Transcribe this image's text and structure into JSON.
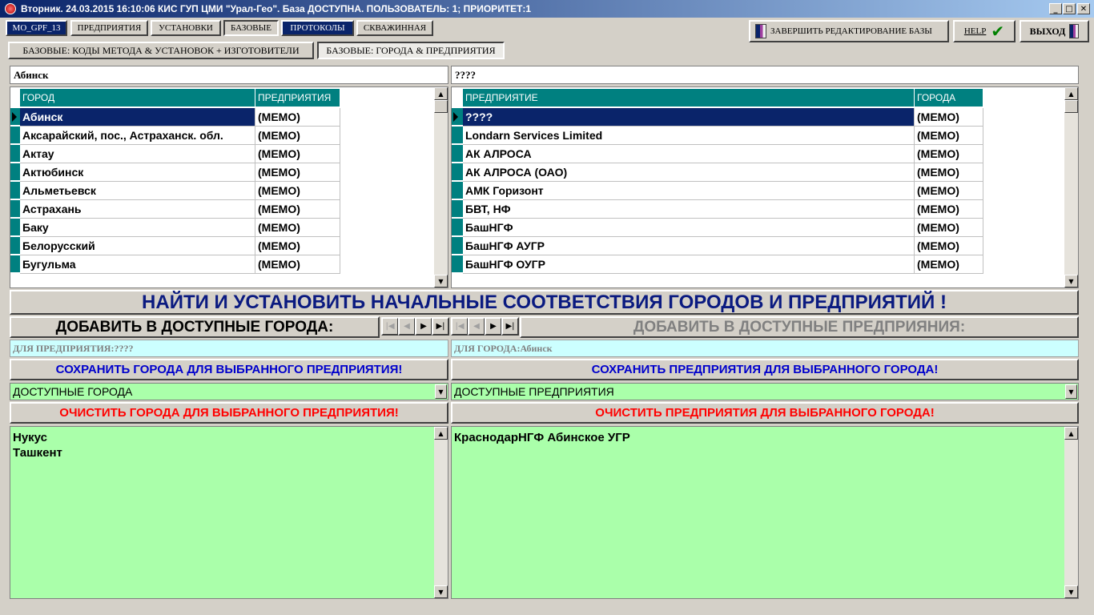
{
  "window": {
    "title": "Вторник. 24.03.2015 16:10:06 КИС ГУП ЦМИ \"Урал-Гео\". База ДОСТУПНА. ПОЛЬЗОВАТЕЛЬ: 1; ПРИОРИТЕТ:1"
  },
  "menu": {
    "mo": "MO_GPF_13",
    "enterprises": "ПРЕДПРИЯТИЯ",
    "installs": "УСТАНОВКИ",
    "base": "БАЗОВЫЕ",
    "protocols": "ПРОТОКОЛЫ",
    "well": "СКВАЖИННАЯ"
  },
  "toolbar": {
    "finish": "ЗАВЕРШИТЬ РЕДАКТИРОВАНИЕ БАЗЫ",
    "help": "HELP",
    "exit": "ВЫХОД"
  },
  "tabs": [
    "БАЗОВЫЕ: КОДЫ МЕТОДА & УСТАНОВОК + ИЗГОТОВИТЕЛИ",
    "БАЗОВЫЕ: ГОРОДА & ПРЕДПРИЯТИЯ"
  ],
  "cities": {
    "search": "Абинск",
    "headers": [
      "ГОРОД",
      "ПРЕДПРИЯТИЯ"
    ],
    "rows": [
      [
        "Абинск",
        "(MEMO)"
      ],
      [
        "Аксарайский, пос., Астраханск. обл.",
        "(MEMO)"
      ],
      [
        "Актау",
        "(MEMO)"
      ],
      [
        "Актюбинск",
        "(MEMO)"
      ],
      [
        "Альметьевск",
        "(MEMO)"
      ],
      [
        "Астрахань",
        "(MEMO)"
      ],
      [
        "Баку",
        "(MEMO)"
      ],
      [
        "Белорусский",
        "(MEMO)"
      ],
      [
        "Бугульма",
        "(MEMO)"
      ]
    ]
  },
  "enterprises": {
    "search": "????",
    "headers": [
      "ПРЕДПРИЯТИЕ",
      "ГОРОДА"
    ],
    "rows": [
      [
        "????",
        "(MEMO)"
      ],
      [
        "Londarn Services Limited",
        "(MEMO)"
      ],
      [
        "АК АЛРОСА",
        "(MEMO)"
      ],
      [
        "АК АЛРОСА (ОАО)",
        "(MEMO)"
      ],
      [
        "АМК Горизонт",
        "(MEMO)"
      ],
      [
        "БВТ, НФ",
        "(MEMO)"
      ],
      [
        "БашНГФ",
        "(MEMO)"
      ],
      [
        "БашНГФ АУГР",
        "(MEMO)"
      ],
      [
        "БашНГФ ОУГР",
        "(MEMO)"
      ]
    ]
  },
  "actions": {
    "find": "НАЙТИ И УСТАНОВИТЬ НАЧАЛЬНЫЕ СООТВЕТСТВИЯ ГОРОДОВ И ПРЕДПРИЯТИЙ !",
    "add_cities": "ДОБАВИТЬ В ДОСТУПНЫЕ ГОРОДА:",
    "add_enterprises": "ДОБАВИТЬ В ДОСТУПНЫЕ ПРЕДПРИЯНИЯ:",
    "for_enterprise": "ДЛЯ ПРЕДПРИЯТИЯ:????",
    "for_city": "ДЛЯ ГОРОДА:Абинск",
    "save_cities": "СОХРАНИТЬ ГОРОДА ДЛЯ ВЫБРАННОГО ПРЕДПРИЯТИЯ!",
    "save_enterprises": "СОХРАНИТЬ ПРЕДПРИЯТИЯ ДЛЯ ВЫБРАННОГО ГОРОДА!",
    "avail_cities": "ДОСТУПНЫЕ ГОРОДА",
    "avail_enterprises": "ДОСТУПНЫЕ ПРЕДПРИЯТИЯ",
    "clear_cities": "ОЧИСТИТЬ ГОРОДА ДЛЯ ВЫБРАННОГО ПРЕДПРИЯТИЯ!",
    "clear_enterprises": "ОЧИСТИТЬ ПРЕДПРИЯТИЯ ДЛЯ ВЫБРАННОГО ГОРОДА!"
  },
  "memo_cities": [
    "Нукус",
    "Ташкент"
  ],
  "memo_enterprises": [
    "КраснодарНГФ Абинское УГР"
  ],
  "colors": {
    "navy": "#0a246a",
    "teal": "#008080",
    "green": "#aaffaa",
    "cyan": "#ccffff",
    "red": "#ff0000",
    "blue": "#0000cc"
  }
}
